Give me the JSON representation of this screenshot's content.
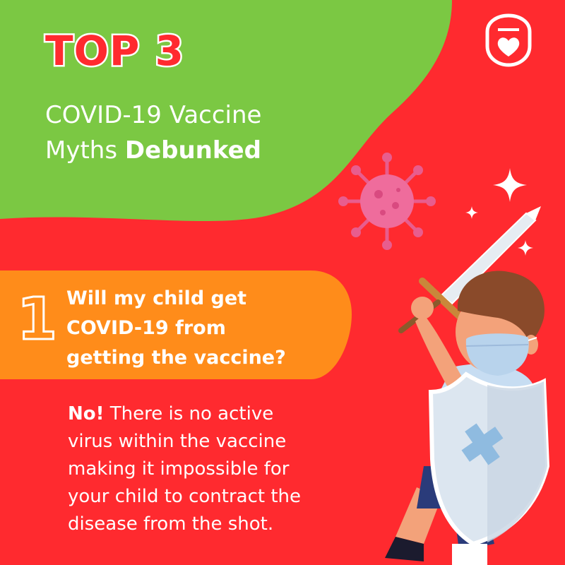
{
  "header": {
    "top_label": "TOP 3",
    "subtitle_line1": "COVID-19 Vaccine",
    "subtitle_line2_regular": "Myths ",
    "subtitle_line2_bold": "Debunked"
  },
  "myth": {
    "number": "1",
    "question_lines": [
      "Will my child get",
      "COVID-19 from",
      "getting the vaccine?"
    ],
    "answer_lead": "No!",
    "answer_lines": [
      " There is no active",
      "virus within the vaccine",
      "making it impossible for",
      "your child to contract the",
      "disease from the shot."
    ]
  },
  "icons": [
    "heart-shell-logo-icon",
    "virus-icon",
    "sparkle-icon",
    "sword-icon",
    "shield-cross-icon",
    "child-illustration"
  ],
  "colors": {
    "red": "#ff2a2f",
    "green": "#7bc843",
    "orange": "#ff8c1a",
    "white": "#ffffff"
  }
}
